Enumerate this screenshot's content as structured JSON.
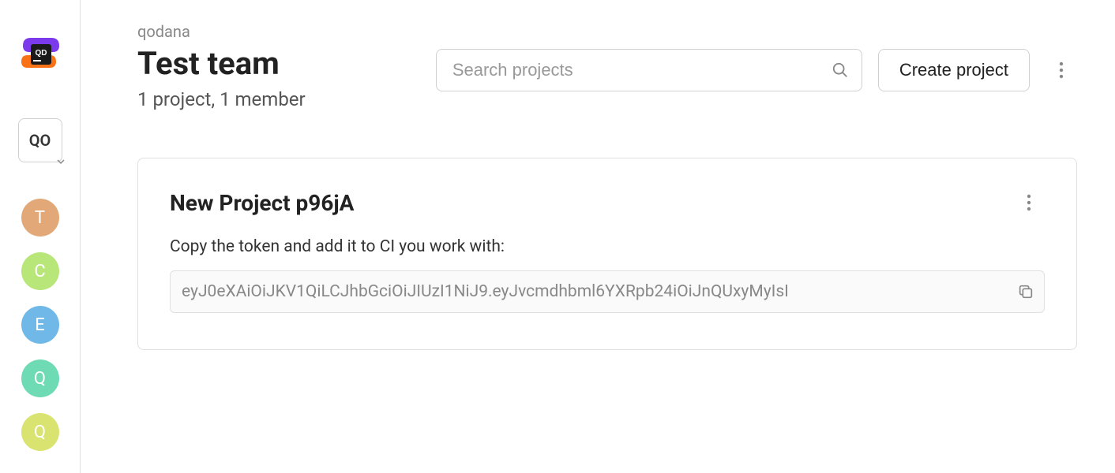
{
  "sidebar": {
    "team_selector_label": "QO",
    "avatars": [
      {
        "label": "T",
        "class": "t"
      },
      {
        "label": "C",
        "class": "c"
      },
      {
        "label": "E",
        "class": "e"
      },
      {
        "label": "Q",
        "class": "q1"
      },
      {
        "label": "Q",
        "class": "q2"
      }
    ]
  },
  "header": {
    "breadcrumb": "qodana",
    "title": "Test team",
    "subtitle": "1 project, 1 member"
  },
  "search": {
    "placeholder": "Search projects"
  },
  "actions": {
    "create_label": "Create project"
  },
  "project": {
    "title": "New Project p96jA",
    "instruction": "Copy the token and add it to CI you work with:",
    "token": "eyJ0eXAiOiJKV1QiLCJhbGciOiJIUzI1NiJ9.eyJvcmdhbml6YXRpb24iOiJnQUxyMyIsI"
  }
}
